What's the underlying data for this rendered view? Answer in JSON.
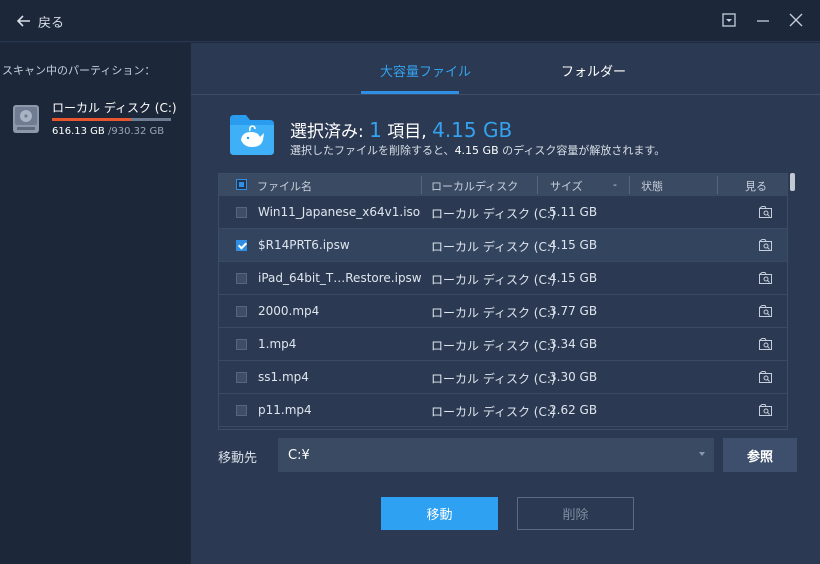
{
  "titlebar": {
    "back_label": "戻る",
    "icons": [
      "back-arrow-icon",
      "dropdown-menu-icon",
      "minimize-icon",
      "close-icon"
    ]
  },
  "sidebar": {
    "title": "スキャン中のパーティション：",
    "partition": {
      "name": "ローカル ディスク (C:)",
      "used": "616.13 GB",
      "total": "/930.32 GB",
      "usage_fraction": 0.662,
      "icon": "hard-disk-icon"
    }
  },
  "tabs": [
    {
      "label": "大容量ファイル",
      "active": true
    },
    {
      "label": "フォルダー",
      "active": false
    }
  ],
  "summary": {
    "prefix": "選択済み: ",
    "count": "1",
    "unit": " 項目, ",
    "size": "4.15 GB",
    "desc_before": "選択したファイルを削除すると、",
    "desc_size": "4.15 GB",
    "desc_after": " のディスク容量が解放されます。",
    "icon": "whale-folder-icon"
  },
  "table": {
    "columns": {
      "name": "ファイル名",
      "disk": "ローカルディスク",
      "size": "サイズ",
      "sort_indicator": "-",
      "status": "状態",
      "view": "見る"
    },
    "rows": [
      {
        "name": "Win11_Japanese_x64v1.iso",
        "disk": "ローカル ディスク (C:)",
        "size": "5.11 GB",
        "checked": false
      },
      {
        "name": "$R14PRT6.ipsw",
        "disk": "ローカル ディスク (C:)",
        "size": "4.15 GB",
        "checked": true
      },
      {
        "name": "iPad_64bit_T…Restore.ipsw",
        "disk": "ローカル ディスク (C:)",
        "size": "4.15 GB",
        "checked": false
      },
      {
        "name": "2000.mp4",
        "disk": "ローカル ディスク (C:)",
        "size": "3.77 GB",
        "checked": false
      },
      {
        "name": "1.mp4",
        "disk": "ローカル ディスク (C:)",
        "size": "3.34 GB",
        "checked": false
      },
      {
        "name": "ss1.mp4",
        "disk": "ローカル ディスク (C:)",
        "size": "3.30 GB",
        "checked": false
      },
      {
        "name": "p11.mp4",
        "disk": "ローカル ディスク (C:)",
        "size": "2.62 GB",
        "checked": false
      }
    ]
  },
  "destination": {
    "label": "移動先",
    "value": "C:¥",
    "browse_label": "参照"
  },
  "actions": {
    "move_label": "移動",
    "delete_label": "削除"
  },
  "colors": {
    "accent": "#2ea1f2",
    "background": "#2b3a52",
    "sidebar": "#1c2739",
    "usage_bar": "#e8552f"
  }
}
